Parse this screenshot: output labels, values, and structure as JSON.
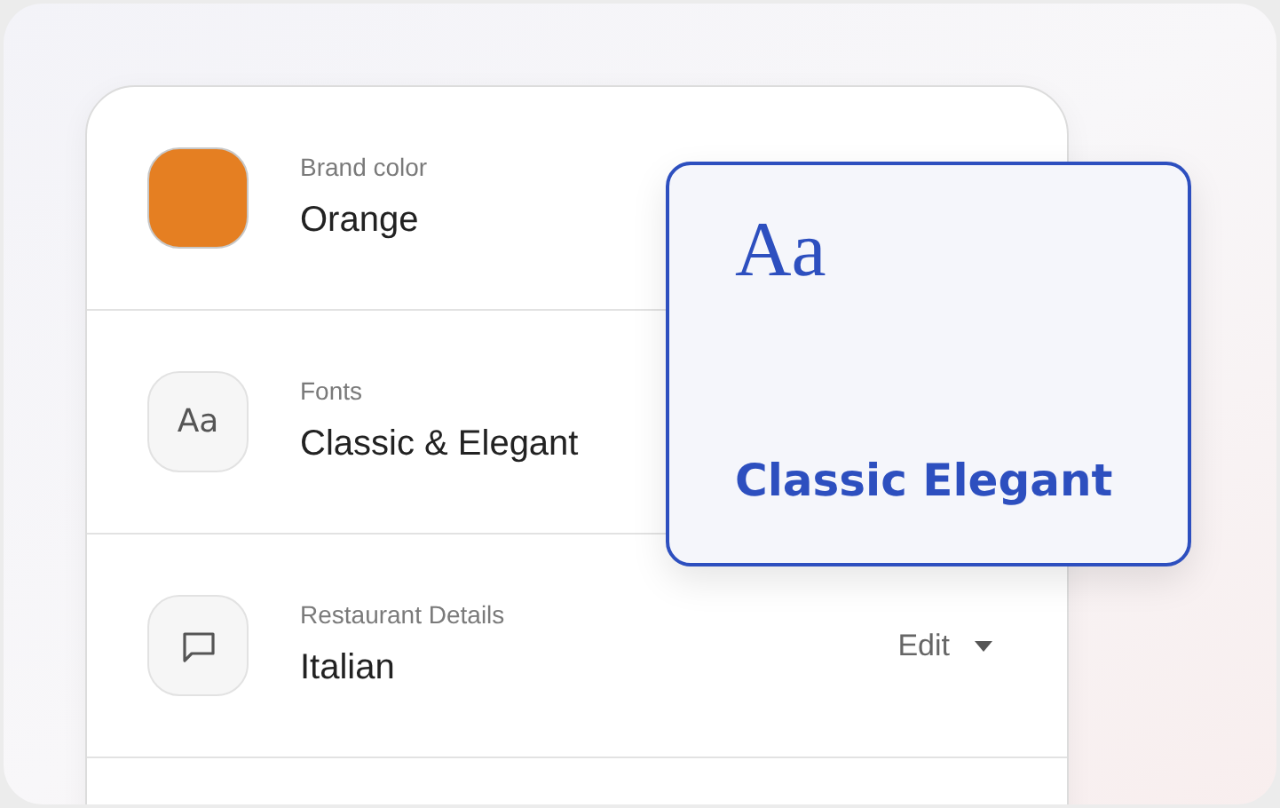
{
  "rows": [
    {
      "kind": "swatch",
      "label": "Brand color",
      "value": "Orange",
      "color": "#e57f22"
    },
    {
      "kind": "glyph",
      "glyph": "Aa",
      "label": "Fonts",
      "value": "Classic & Elegant"
    },
    {
      "kind": "chat",
      "label": "Restaurant Details",
      "value": "Italian",
      "action": "Edit"
    }
  ],
  "preview": {
    "sample": "Aa",
    "name": "Classic Elegant"
  }
}
